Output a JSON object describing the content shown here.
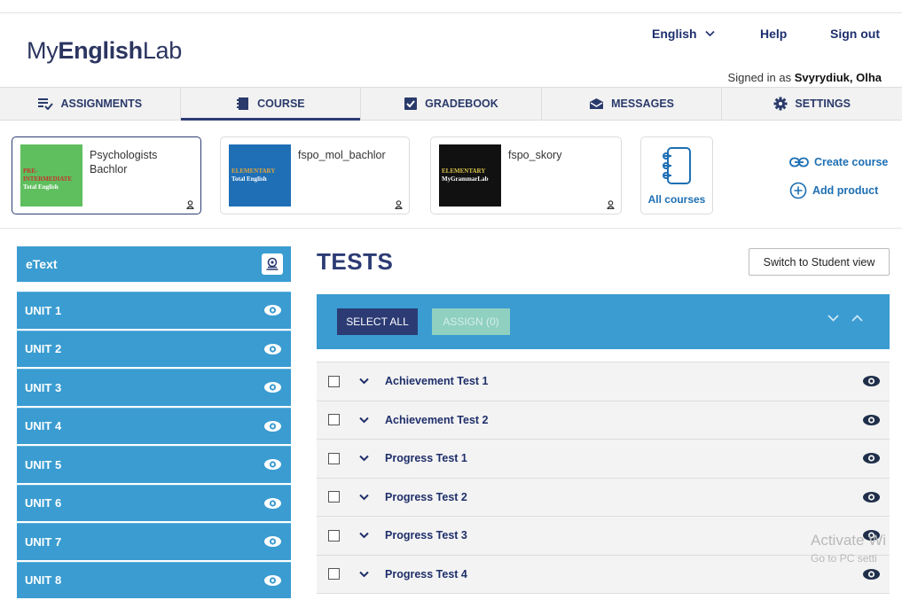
{
  "header": {
    "logo_my": "My",
    "logo_english": "English",
    "logo_lab": "Lab",
    "language": "English",
    "help": "Help",
    "sign_out": "Sign out",
    "signed_in_prefix": "Signed in as",
    "user_name": "Svyrydiuk, Olha"
  },
  "nav": {
    "assignments": "ASSIGNMENTS",
    "course": "COURSE",
    "gradebook": "GRADEBOOK",
    "messages": "MESSAGES",
    "settings": "SETTINGS"
  },
  "courses": [
    {
      "name_line1": "Psychologists",
      "name_line2": "Bachlor",
      "thumb_line1": "PRE-",
      "thumb_line2": "INTERMEDIATE",
      "thumb_line3": "Total English",
      "thumb_color": "#5fbf5e"
    },
    {
      "name_line1": "fspo_mol_bachlor",
      "name_line2": "",
      "thumb_line1": "",
      "thumb_line2": "ELEMENTARY",
      "thumb_line3": "Total English",
      "thumb_color": "#1f6fb6"
    },
    {
      "name_line1": "fspo_skory",
      "name_line2": "",
      "thumb_line1": "",
      "thumb_line2": "ELEMENTARY",
      "thumb_line3": "MyGrammarLab",
      "thumb_color": "#111111"
    }
  ],
  "all_courses": "All courses",
  "create_course": "Create course",
  "add_product": "Add product",
  "sidebar": {
    "etext": "eText",
    "units": [
      "UNIT 1",
      "UNIT 2",
      "UNIT 3",
      "UNIT 4",
      "UNIT 5",
      "UNIT 6",
      "UNIT 7",
      "UNIT 8"
    ]
  },
  "main": {
    "title": "TESTS",
    "switch_view": "Switch to Student view",
    "select_all": "SELECT ALL",
    "assign": "ASSIGN (0)",
    "tests": [
      "Achievement Test 1",
      "Achievement Test 2",
      "Progress Test 1",
      "Progress Test 2",
      "Progress Test 3",
      "Progress Test 4"
    ]
  },
  "watermark": {
    "line1": "Activate Wi",
    "line2": "Go to PC setti"
  },
  "colors": {
    "primary": "#2c3b74",
    "accent": "#3a9cd1",
    "link": "#1e6fb3",
    "assign_disabled": "#8fd0c0"
  }
}
